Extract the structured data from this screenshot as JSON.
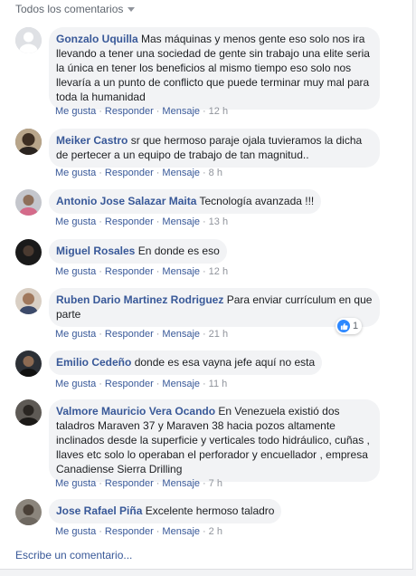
{
  "header": {
    "sort_label": "Todos los comentarios"
  },
  "actions": {
    "like": "Me gusta",
    "reply": "Responder",
    "message": "Mensaje",
    "sep": "·"
  },
  "comments": [
    {
      "author": "Gonzalo Uquilla",
      "text": "Mas máquinas y menos gente eso solo nos ira llevando a tener una sociedad de gente sin trabajo una elite seria la única en tener los beneficios al mismo tiempo eso solo nos llevaría a un punto de conflicto que puede terminar muy mal para toda la humanidad",
      "time": "12 h"
    },
    {
      "author": "Meiker Castro",
      "text": "sr que hermoso paraje ojala tuvieramos la dicha de pertecer a un equipo de trabajo de tan magnitud..",
      "time": "8 h"
    },
    {
      "author": "Antonio Jose Salazar Maita",
      "text": "Tecnología avanzada !!!",
      "time": "13 h"
    },
    {
      "author": "Miguel Rosales",
      "text": "En donde es eso",
      "time": "12 h"
    },
    {
      "author": "Ruben Dario Martinez Rodriguez",
      "text": "Para enviar currículum en que parte",
      "time": "21 h",
      "reaction_count": "1"
    },
    {
      "author": "Emilio Cedeño",
      "text": "donde es esa vayna jefe aquí no esta",
      "time": "11 h"
    },
    {
      "author": "Valmore Mauricio Vera Ocando",
      "text": "En Venezuela existió dos taladros Maraven 37 y Maraven 38 hacia pozos altamente inclinados desde la superficie y verticales todo hidráulico, cuñas , llaves etc solo lo operaban el perforador y encuellador , empresa Canadiense Sierra Drilling",
      "time": "7 h"
    },
    {
      "author": "Jose Rafael Piña",
      "text": "Excelente hermoso taladro",
      "time": "2 h"
    }
  ],
  "footer": {
    "write_placeholder": "Escribe un comentario..."
  },
  "colors": {
    "link": "#385898",
    "meta": "#90949c",
    "bubble": "#f2f3f5",
    "like_badge": "#2d88ff"
  },
  "icons": {
    "sort": "caret-down-icon",
    "reaction": "like-thumb-icon"
  }
}
